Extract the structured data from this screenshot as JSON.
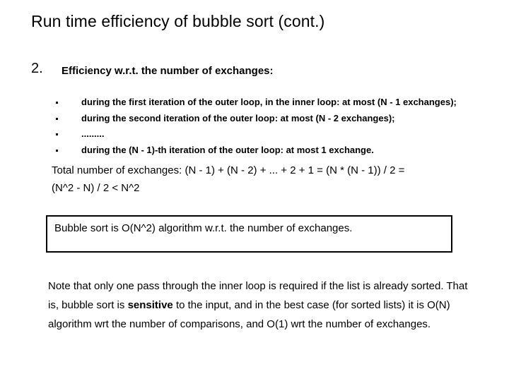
{
  "title": "Run time efficiency of bubble sort (cont.)",
  "section": {
    "number": "2.",
    "heading": "Efficiency  w.r.t. the number of exchanges:"
  },
  "bullets": [
    "during the first iteration of the outer loop, in the inner loop: at most (N - 1 exchanges);",
    "during the second iteration of the outer loop: at most (N - 2 exchanges);",
    ".........",
    "during the (N - 1)-th iteration of the outer loop: at most 1 exchange."
  ],
  "total": {
    "line1": "Total number of exchanges: (N - 1) + (N - 2) + ... + 2 + 1 = (N * (N - 1)) / 2 =",
    "line2": "(N^2 - N) / 2 < N^2"
  },
  "conclusion_box": "Bubble sort is O(N^2) algorithm w.r.t. the number of exchanges.",
  "note": {
    "before": "Note that only one pass through the inner loop is required if the list is already sorted. That is, bubble sort is ",
    "emphasis": "sensitive",
    "after": " to the input, and in the best case (for sorted lists) it is O(N) algorithm wrt the number of comparisons, and O(1) wrt the number of exchanges."
  }
}
